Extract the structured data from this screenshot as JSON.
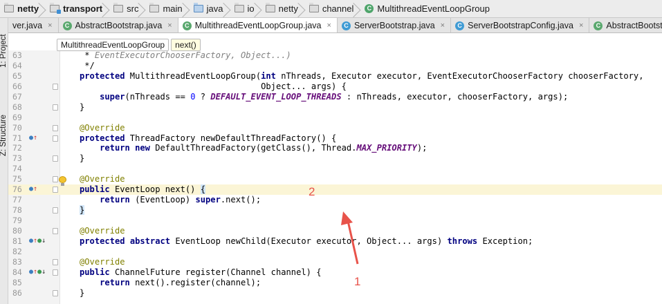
{
  "breadcrumbs": [
    {
      "label": "netty",
      "icon": "folder-icon",
      "bold": true
    },
    {
      "label": "transport",
      "icon": "module-folder-icon",
      "bold": true
    },
    {
      "label": "src",
      "icon": "folder-icon",
      "bold": false
    },
    {
      "label": "main",
      "icon": "folder-icon",
      "bold": false
    },
    {
      "label": "java",
      "icon": "source-folder-icon",
      "bold": false
    },
    {
      "label": "io",
      "icon": "folder-icon",
      "bold": false
    },
    {
      "label": "netty",
      "icon": "folder-icon",
      "bold": false
    },
    {
      "label": "channel",
      "icon": "folder-icon",
      "bold": false
    },
    {
      "label": "MultithreadEventLoopGroup",
      "icon": "abstract-class-icon",
      "bold": false
    }
  ],
  "tabs": [
    {
      "label": "ver.java",
      "icon": "none",
      "active": false
    },
    {
      "label": "AbstractBootstrap.java",
      "icon": "abstract-class-icon",
      "active": false
    },
    {
      "label": "MultithreadEventLoopGroup.java",
      "icon": "abstract-class-icon",
      "active": true
    },
    {
      "label": "ServerBootstrap.java",
      "icon": "class-icon",
      "active": false
    },
    {
      "label": "ServerBootstrapConfig.java",
      "icon": "class-icon",
      "active": false
    },
    {
      "label": "AbstractBootstrap",
      "icon": "abstract-class-icon",
      "active": false
    }
  ],
  "tool_windows": {
    "project": "1: Project",
    "structure": "Z: Structure"
  },
  "code_header": {
    "class_chip": "MultithreadEventLoopGroup",
    "method_chip": "next()"
  },
  "code": [
    {
      "n": "63",
      "html": " * <span class=\"cm\">EventExecutorChooserFactory, Object...)</span>",
      "gutter": ""
    },
    {
      "n": "64",
      "html": " */",
      "gutter": ""
    },
    {
      "n": "65",
      "html": "",
      "gutter": ""
    },
    {
      "n": "66",
      "html": "",
      "gutter": ""
    },
    {
      "n": "67",
      "html": "",
      "gutter": ""
    },
    {
      "n": "68",
      "html": "",
      "gutter": ""
    },
    {
      "n": "69",
      "html": "",
      "gutter": ""
    },
    {
      "n": "70",
      "html": "",
      "gutter": ""
    },
    {
      "n": "71",
      "html": "",
      "gutter": "override"
    },
    {
      "n": "72",
      "html": "",
      "gutter": ""
    },
    {
      "n": "73",
      "html": "",
      "gutter": ""
    },
    {
      "n": "74",
      "html": "",
      "gutter": ""
    },
    {
      "n": "75",
      "html": "",
      "gutter": ""
    },
    {
      "n": "76",
      "html": "",
      "gutter": "override"
    },
    {
      "n": "77",
      "html": "",
      "gutter": ""
    },
    {
      "n": "78",
      "html": "",
      "gutter": ""
    },
    {
      "n": "79",
      "html": "",
      "gutter": ""
    },
    {
      "n": "80",
      "html": "",
      "gutter": ""
    },
    {
      "n": "81",
      "html": "",
      "gutter": "implemented"
    },
    {
      "n": "82",
      "html": "",
      "gutter": ""
    },
    {
      "n": "83",
      "html": "",
      "gutter": ""
    },
    {
      "n": "84",
      "html": "",
      "gutter": "implemented"
    },
    {
      "n": "85",
      "html": "",
      "gutter": ""
    },
    {
      "n": "86",
      "html": "",
      "gutter": ""
    }
  ],
  "code_text": [
    " * EventExecutorChooserFactory, Object...)",
    " */",
    "protected MultithreadEventLoopGroup(int nThreads, Executor executor, EventExecutorChooserFactory chooserFactory,",
    "                                    Object... args) {",
    "    super(nThreads == 0 ? DEFAULT_EVENT_LOOP_THREADS : nThreads, executor, chooserFactory, args);",
    "}",
    "",
    "@Override",
    "protected ThreadFactory newDefaultThreadFactory() {",
    "    return new DefaultThreadFactory(getClass(), Thread.MAX_PRIORITY);",
    "}",
    "",
    "@Override",
    "public EventLoop next() {",
    "    return (EventLoop) super.next();",
    "}",
    "",
    "@Override",
    "protected abstract EventLoop newChild(Executor executor, Object... args) throws Exception;",
    "",
    "@Override",
    "public ChannelFuture register(Channel channel) {",
    "    return next().register(channel);",
    "}"
  ],
  "annotations": {
    "label_1": "1",
    "label_2": "2",
    "color": "#e8534a"
  }
}
